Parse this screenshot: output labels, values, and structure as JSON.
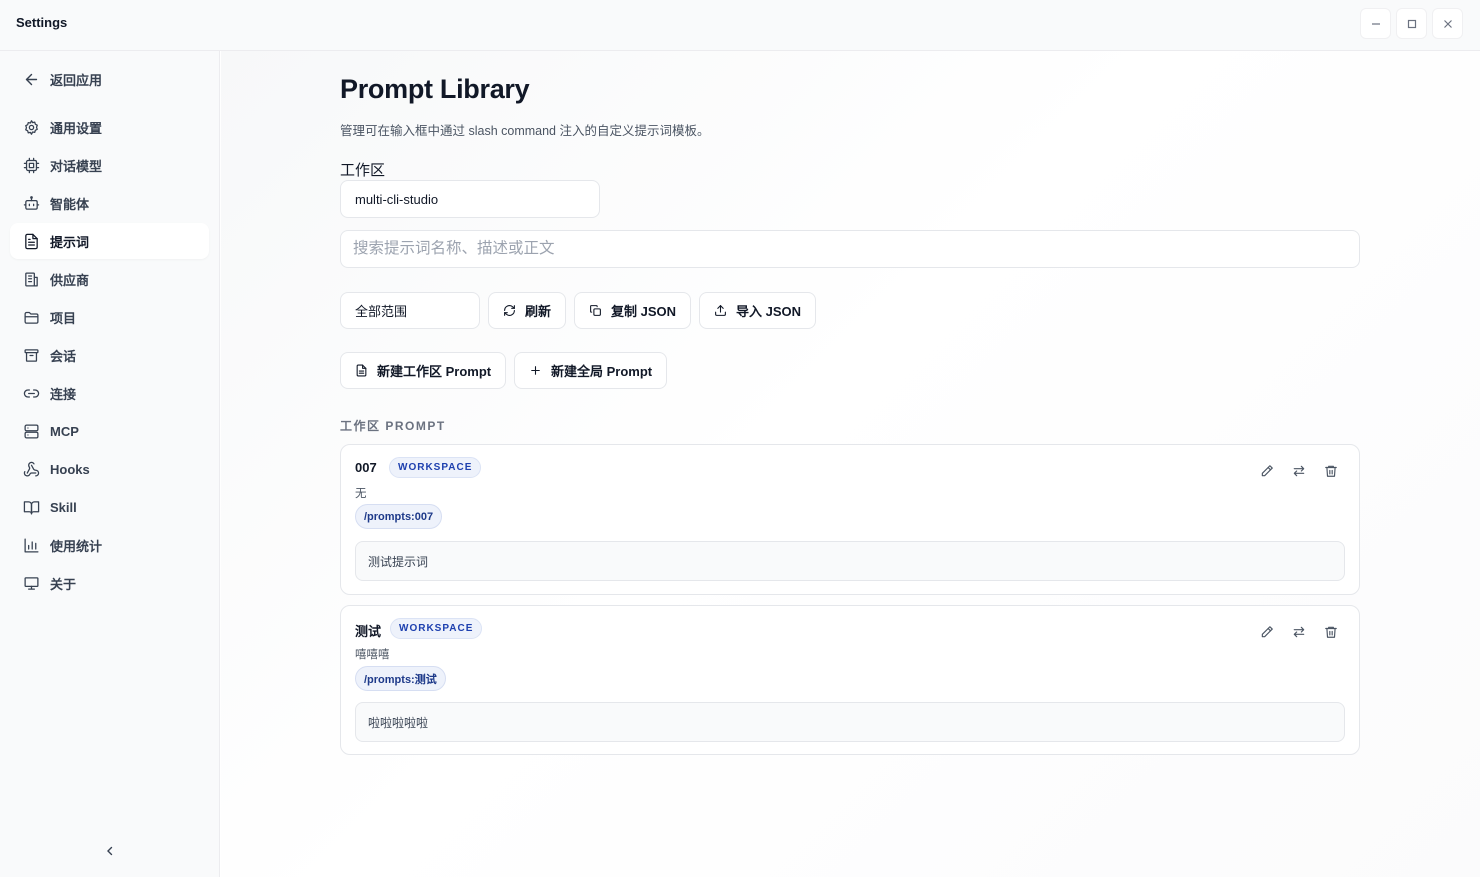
{
  "window": {
    "title": "Settings"
  },
  "sidebar": {
    "back_label": "返回应用",
    "items": [
      {
        "label": "通用设置",
        "icon": "gear-icon"
      },
      {
        "label": "对话模型",
        "icon": "chip-icon"
      },
      {
        "label": "智能体",
        "icon": "bot-icon"
      },
      {
        "label": "提示词",
        "icon": "file-text-icon",
        "active": true
      },
      {
        "label": "供应商",
        "icon": "building-icon"
      },
      {
        "label": "项目",
        "icon": "folder-icon"
      },
      {
        "label": "会话",
        "icon": "archive-icon"
      },
      {
        "label": "连接",
        "icon": "link-icon"
      },
      {
        "label": "MCP",
        "icon": "server-icon"
      },
      {
        "label": "Hooks",
        "icon": "webhook-icon"
      },
      {
        "label": "Skill",
        "icon": "book-icon"
      },
      {
        "label": "使用统计",
        "icon": "bar-chart-icon"
      },
      {
        "label": "关于",
        "icon": "monitor-icon"
      }
    ]
  },
  "main": {
    "title": "Prompt Library",
    "description": "管理可在输入框中通过 slash command 注入的自定义提示词模板。",
    "workspace_label": "工作区",
    "workspace_value": "multi-cli-studio",
    "search_placeholder": "搜索提示词名称、描述或正文",
    "scope_value": "全部范围",
    "refresh_label": "刷新",
    "copy_json_label": "复制 JSON",
    "import_json_label": "导入 JSON",
    "new_workspace_prompt_label": "新建工作区 Prompt",
    "new_global_prompt_label": "新建全局 Prompt",
    "section_label": "工作区 PROMPT",
    "prompts": [
      {
        "name": "007",
        "badge": "WORKSPACE",
        "description": "无",
        "command": "/prompts:007",
        "body": "测试提示词"
      },
      {
        "name": "测试",
        "badge": "WORKSPACE",
        "description": "嘻嘻嘻",
        "command": "/prompts:测试",
        "body": "啦啦啦啦啦"
      }
    ]
  },
  "colors": {
    "accent_badge_bg": "#eef2fb",
    "accent_badge_text": "#1e40af",
    "sidebar_bg": "#f9fafb"
  }
}
